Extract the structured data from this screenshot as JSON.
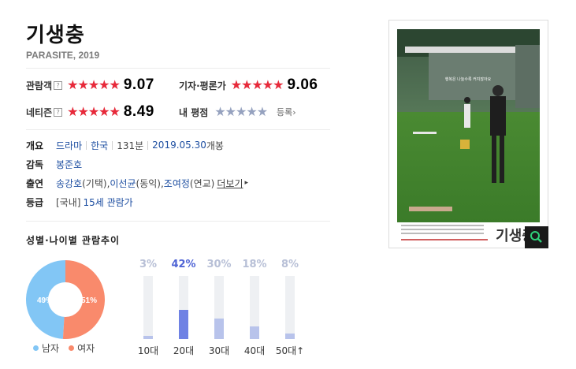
{
  "movie": {
    "title": "기생충",
    "subtitle": "PARASITE, 2019"
  },
  "ratings": {
    "audience": {
      "label": "관람객",
      "help": "?",
      "score": "9.07",
      "fraction": 0.907
    },
    "critic": {
      "label": "기자·평론가",
      "score": "9.06",
      "fraction": 0.906
    },
    "netizen": {
      "label": "네티즌",
      "help": "?",
      "score": "8.49",
      "fraction": 0.849
    },
    "mine": {
      "label": "내 평점",
      "link": "등록",
      "arrow": "›",
      "fraction": 0
    }
  },
  "stars_glyph": "★★★★★",
  "info": {
    "overview": {
      "label": "개요",
      "genre": "드라마",
      "country": "한국",
      "runtime": "131분",
      "release_date": "2019.05.30",
      "release_suffix": " 개봉"
    },
    "director": {
      "label": "감독",
      "name": "봉준호"
    },
    "cast": {
      "label": "출연",
      "actors": [
        {
          "name": "송강호",
          "role": "(기택), "
        },
        {
          "name": "이선균",
          "role": "(동익), "
        },
        {
          "name": "조여정",
          "role": "(연교) "
        }
      ],
      "more": "더보기",
      "more_arrow": "▸"
    },
    "grade": {
      "label": "등급",
      "prefix": "[국내]",
      "value": "15세 관람가"
    }
  },
  "trend": {
    "title": "성별·나이별 관람추이",
    "gender": {
      "male": {
        "label": "남자",
        "pct_text": "49%",
        "value": 49,
        "color": "#82c6f5"
      },
      "female": {
        "label": "여자",
        "pct_text": "51%",
        "value": 51,
        "color": "#f98a6c"
      }
    },
    "ages": [
      {
        "label": "10대",
        "pct": "3%",
        "value": 3
      },
      {
        "label": "20대",
        "pct": "42%",
        "value": 42,
        "highlight": true
      },
      {
        "label": "30대",
        "pct": "30%",
        "value": 30
      },
      {
        "label": "40대",
        "pct": "18%",
        "value": 18
      },
      {
        "label": "50대↑",
        "pct": "8%",
        "value": 8
      }
    ]
  },
  "poster": {
    "tagline": "행복은 나눌수록 커지잖아요",
    "logo": "기생충",
    "zoom_icon": "search-icon"
  },
  "colors": {
    "star_red": "#e8293a",
    "star_blue": "#96a2bf",
    "link_blue": "#1d4ea1",
    "age_active": "#4f64d5"
  }
}
